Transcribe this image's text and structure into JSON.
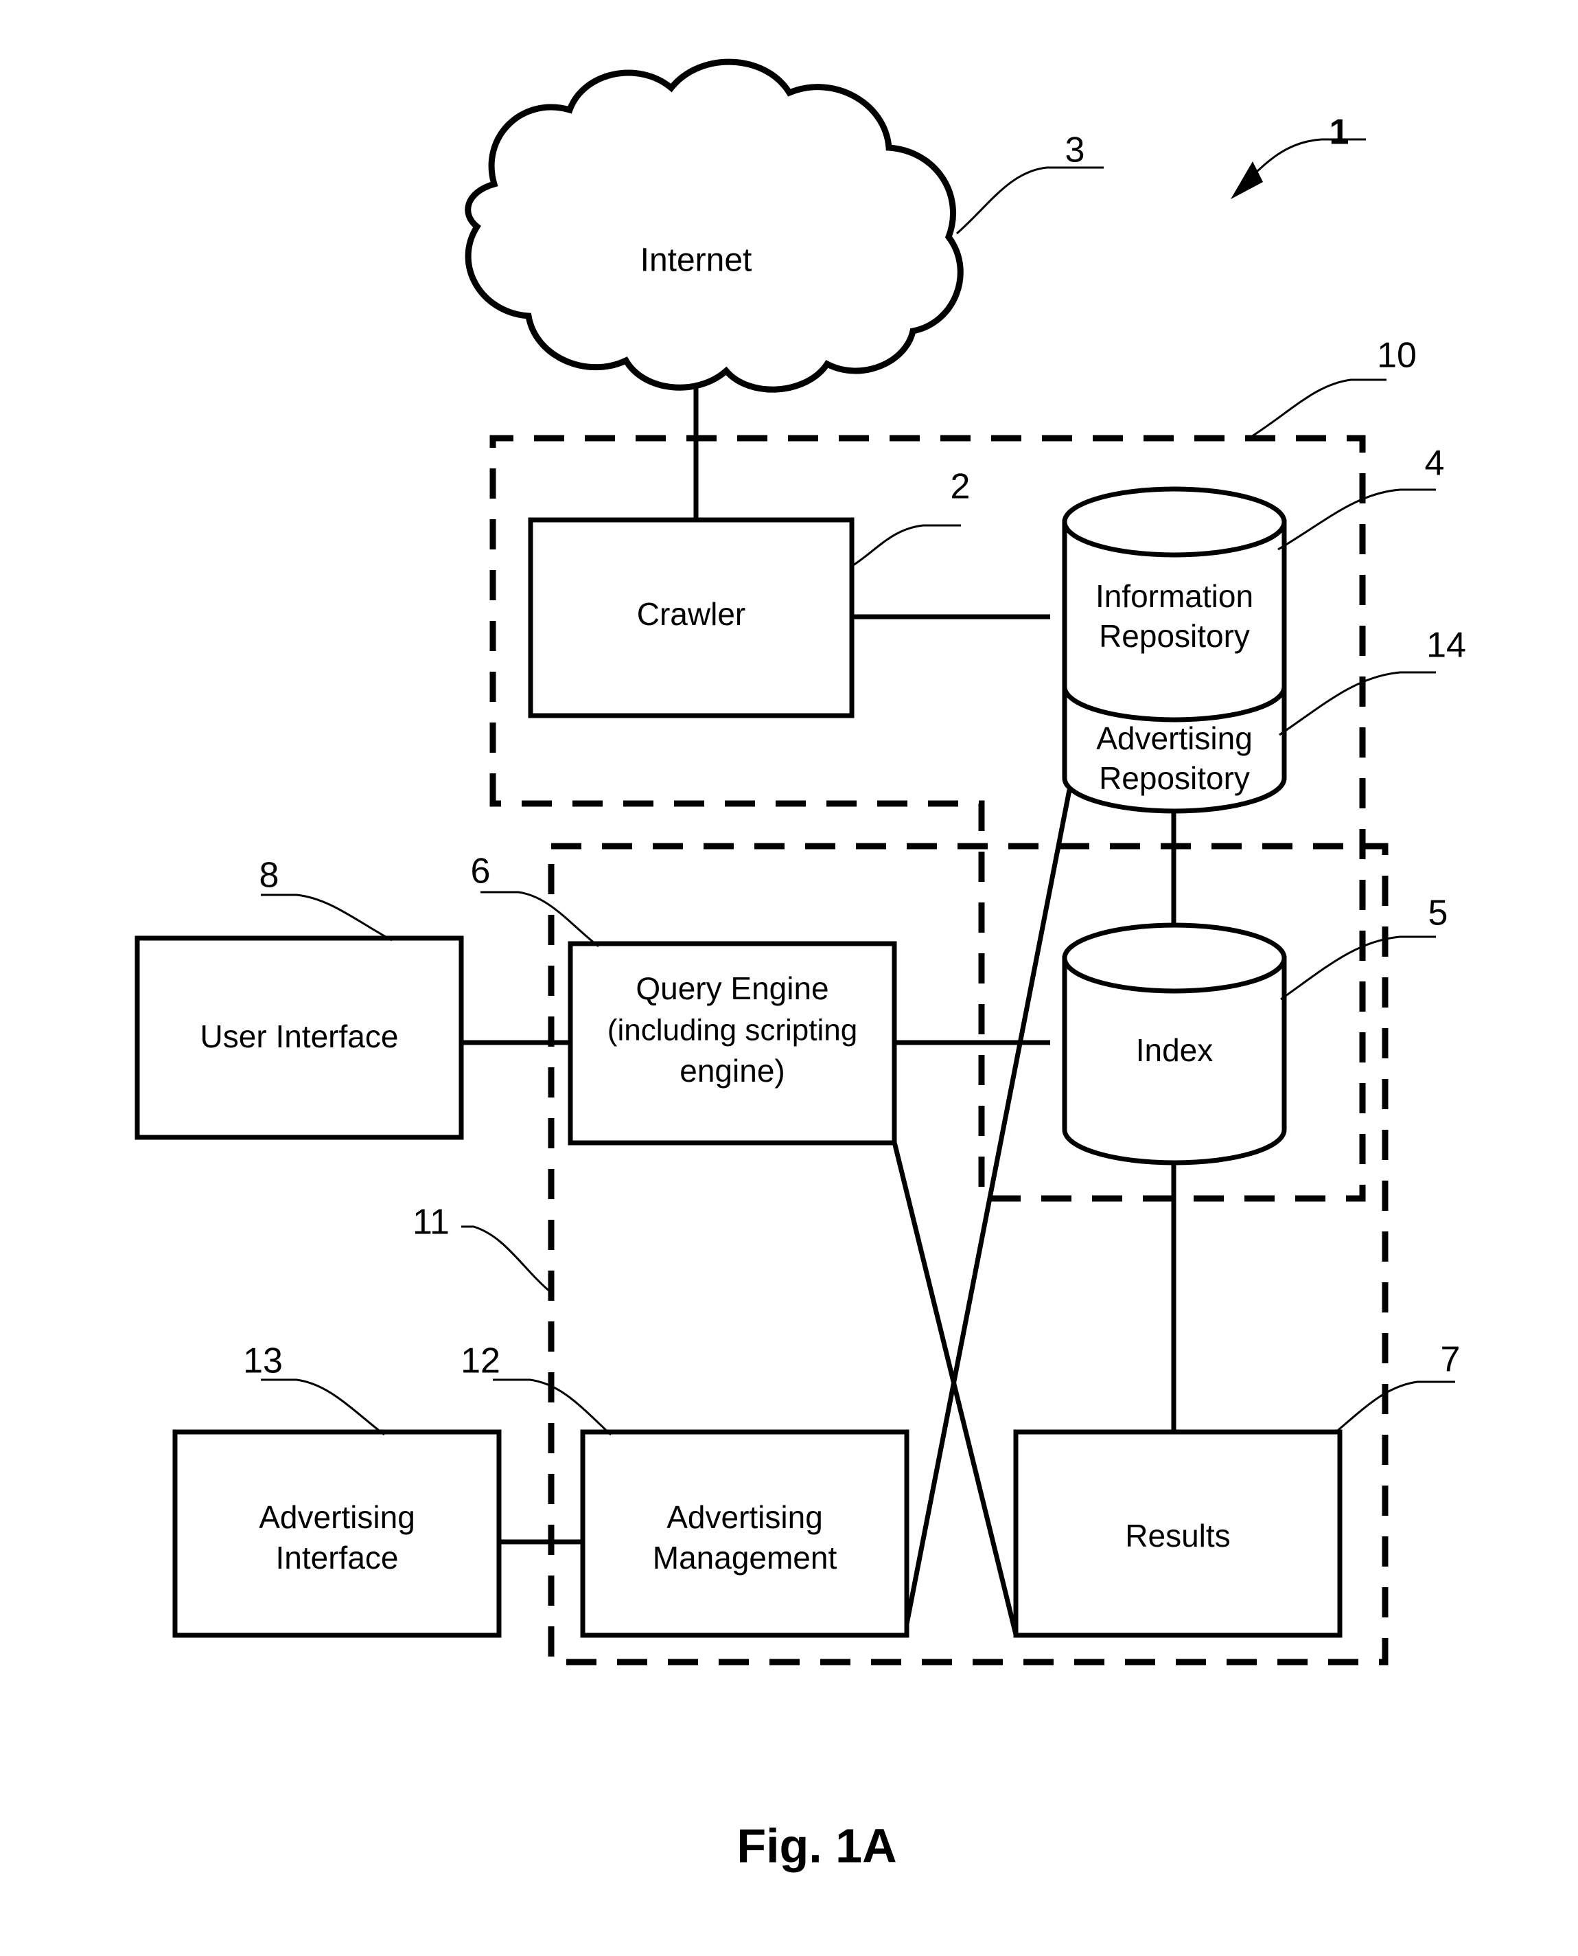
{
  "figure": {
    "caption": "Fig. 1A",
    "system_ref": "1"
  },
  "nodes": {
    "internet": {
      "label": "Internet",
      "ref": "3",
      "shape": "cloud"
    },
    "crawler": {
      "label": "Crawler",
      "ref": "2",
      "shape": "rectangle"
    },
    "information_repository": {
      "label_line1": "Information",
      "label_line2": "Repository",
      "ref": "4",
      "shape": "cylinder"
    },
    "advertising_repository": {
      "label_line1": "Advertising",
      "label_line2": "Repository",
      "ref": "14",
      "shape": "cylinder-section"
    },
    "index": {
      "label": "Index",
      "ref": "5",
      "shape": "cylinder"
    },
    "user_interface": {
      "label": "User Interface",
      "ref": "8",
      "shape": "rectangle"
    },
    "query_engine": {
      "label_line1": "Query Engine",
      "label_line2": "(including scripting",
      "label_line3": "engine)",
      "ref": "6",
      "shape": "rectangle"
    },
    "results": {
      "label": "Results",
      "ref": "7",
      "shape": "rectangle"
    },
    "advertising_interface": {
      "label_line1": "Advertising",
      "label_line2": "Interface",
      "ref": "13",
      "shape": "rectangle"
    },
    "advertising_management": {
      "label_line1": "Advertising",
      "label_line2": "Management",
      "ref": "12",
      "shape": "rectangle"
    }
  },
  "groups": {
    "crawl_subsystem": {
      "ref": "10",
      "style": "dashed"
    },
    "search_subsystem": {
      "ref": "11",
      "style": "dashed"
    }
  },
  "colors": {
    "stroke": "#000000",
    "fill": "#ffffff",
    "background": "#ffffff"
  }
}
